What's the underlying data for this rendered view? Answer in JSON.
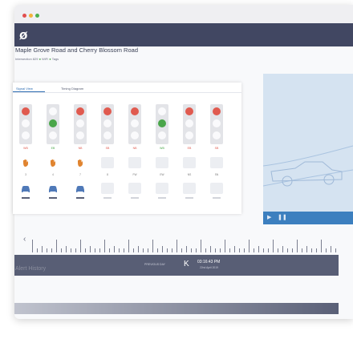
{
  "window": {
    "dots": [
      "#e14f4f",
      "#f2b33a",
      "#4cb04f"
    ]
  },
  "topbar": {
    "logo_glyph": "ø"
  },
  "page": {
    "title": "Maple Grove Road and Cherry Blossom Road",
    "intersection_id": "Intersection 829",
    "wifi_label": "WiFi",
    "tags_label": "Tags"
  },
  "signal_panel": {
    "tabs": [
      {
        "label": "Signal View",
        "active": true
      },
      {
        "label": "Timing Diagram",
        "active": false
      }
    ],
    "columns": [
      {
        "phase": "WB",
        "phase_color": "#e05a4f",
        "lamps": [
          "red",
          "off",
          "off"
        ],
        "ped": "hand",
        "ped_label": "3",
        "vehicle": "car",
        "bar": "#5a6077"
      },
      {
        "phase": "EB",
        "phase_color": "#4aa64a",
        "lamps": [
          "off",
          "green",
          "off"
        ],
        "ped": "hand",
        "ped_label": "4",
        "vehicle": "car",
        "bar": "#5a6077"
      },
      {
        "phase": "NB",
        "phase_color": "#e05a4f",
        "lamps": [
          "red",
          "off",
          "off"
        ],
        "ped": "hand",
        "ped_label": "7",
        "vehicle": "car",
        "bar": "#5a6077"
      },
      {
        "phase": "SB",
        "phase_color": "#e05a4f",
        "lamps": [
          "red",
          "off",
          "off"
        ],
        "ped": "off",
        "ped_label": "8",
        "vehicle": "off",
        "bar": "#d2d4db"
      },
      {
        "phase": "NB",
        "phase_color": "#e05a4f",
        "lamps": [
          "red",
          "off",
          "off"
        ],
        "ped": "off",
        "ped_label": "FW",
        "vehicle": "off",
        "bar": "#d2d4db"
      },
      {
        "phase": "WB",
        "phase_color": "#4aa64a",
        "lamps": [
          "off",
          "green",
          "off"
        ],
        "ped": "off",
        "ped_label": "EW",
        "vehicle": "off",
        "bar": "#d2d4db"
      },
      {
        "phase": "EB",
        "phase_color": "#e05a4f",
        "lamps": [
          "red",
          "off",
          "off"
        ],
        "ped": "off",
        "ped_label": "NS",
        "vehicle": "off",
        "bar": "#d2d4db"
      },
      {
        "phase": "SB",
        "phase_color": "#e05a4f",
        "lamps": [
          "red",
          "off",
          "off"
        ],
        "ped": "off",
        "ped_label": "SN",
        "vehicle": "off",
        "bar": "#d2d4db"
      }
    ]
  },
  "video": {
    "controls": [
      "▶",
      "❚❚"
    ]
  },
  "timeline": {
    "prev_arrow": "‹"
  },
  "playback": {
    "prev_label": "PREVIOUS DAY",
    "control_glyph": "K",
    "time": "03:16:43 PM",
    "date": "22nd April 2019"
  },
  "alerts": {
    "title": "Alert History"
  },
  "colors": {
    "red": "#e05a4f",
    "green": "#4aa64a",
    "hand": "#e08430",
    "car": "#4f79b8",
    "accent": "#2f6eb3",
    "nav": "#414762"
  }
}
